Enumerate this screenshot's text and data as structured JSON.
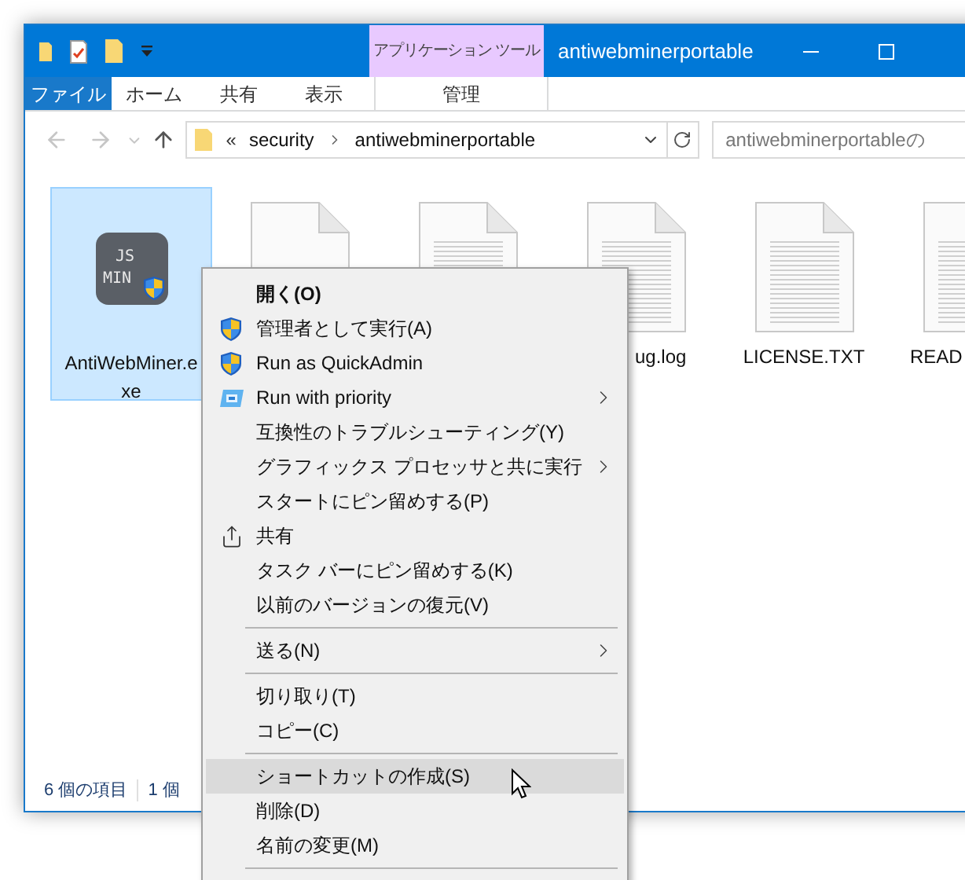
{
  "window": {
    "title": "antiwebminerportable"
  },
  "contextual_group": {
    "label": "アプリケーション ツール"
  },
  "ribbon_tabs": [
    {
      "label": "ファイル",
      "kind": "file"
    },
    {
      "label": "ホーム",
      "kind": "tab"
    },
    {
      "label": "共有",
      "kind": "tab"
    },
    {
      "label": "表示",
      "kind": "tab"
    },
    {
      "label": "管理",
      "kind": "contextual"
    }
  ],
  "address": {
    "overflow": "«",
    "segments": [
      "security",
      "antiwebminerportable"
    ]
  },
  "search": {
    "placeholder": "antiwebminerportableの"
  },
  "files": [
    {
      "kind": "exe",
      "name": "AntiWebMiner.exe",
      "icon_lines": [
        "JS",
        "MIN"
      ],
      "selected": true
    },
    {
      "kind": "gear",
      "selected": false
    },
    {
      "kind": "text",
      "selected": false
    },
    {
      "kind": "text_cut_start",
      "name": "ug.log",
      "selected": false
    },
    {
      "kind": "text",
      "name": "LICENSE.TXT",
      "selected": false
    },
    {
      "kind": "text_cut_end",
      "name": "READ",
      "selected": false
    }
  ],
  "status_bar": {
    "count": "6 個の項目",
    "selection": "1 個"
  },
  "context_menu": [
    {
      "kind": "item",
      "label": "開く(O)",
      "default": true,
      "selected": false
    },
    {
      "kind": "shield",
      "label": "管理者として実行(A)",
      "selected": false
    },
    {
      "kind": "shield",
      "label": "Run as QuickAdmin",
      "selected": false
    },
    {
      "kind": "priority",
      "label": "Run with priority",
      "submenu": true,
      "selected": false
    },
    {
      "kind": "item",
      "label": "互換性のトラブルシューティング(Y)",
      "selected": false
    },
    {
      "kind": "item",
      "label": "グラフィックス プロセッサと共に実行",
      "submenu": true,
      "selected": false
    },
    {
      "kind": "item",
      "label": "スタートにピン留めする(P)",
      "selected": false
    },
    {
      "kind": "share",
      "label": "共有",
      "selected": false
    },
    {
      "kind": "item",
      "label": "タスク バーにピン留めする(K)",
      "selected": false
    },
    {
      "kind": "item",
      "label": "以前のバージョンの復元(V)",
      "selected": false
    },
    {
      "kind": "separator"
    },
    {
      "kind": "item",
      "label": "送る(N)",
      "submenu": true,
      "selected": false
    },
    {
      "kind": "separator"
    },
    {
      "kind": "item",
      "label": "切り取り(T)",
      "selected": false
    },
    {
      "kind": "item",
      "label": "コピー(C)",
      "selected": false
    },
    {
      "kind": "separator"
    },
    {
      "kind": "item",
      "label": "ショートカットの作成(S)",
      "selected": true
    },
    {
      "kind": "item",
      "label": "削除(D)",
      "selected": false
    },
    {
      "kind": "item",
      "label": "名前の変更(M)",
      "selected": false
    },
    {
      "kind": "separator"
    }
  ]
}
